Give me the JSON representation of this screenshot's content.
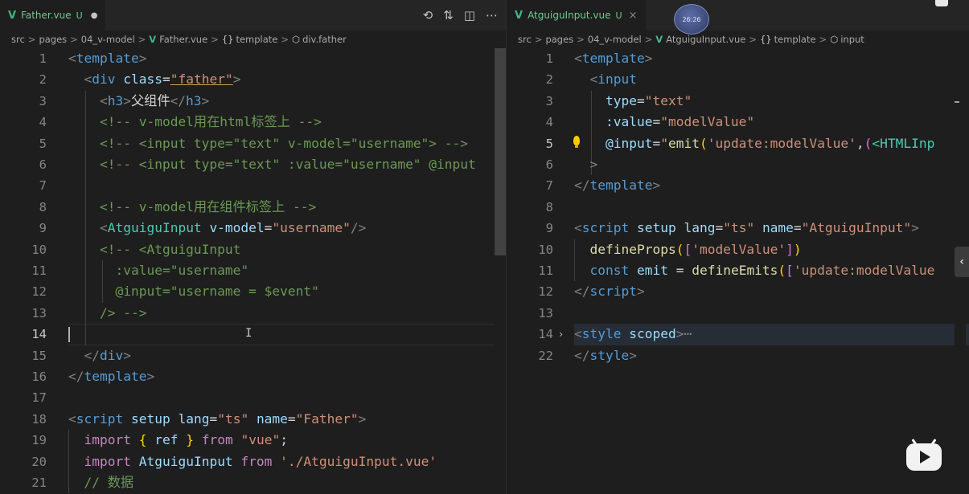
{
  "left": {
    "tab": {
      "vue_icon": "V",
      "name": "Father.vue",
      "status": "U",
      "dirty": "●"
    },
    "actions": {
      "history_icon": "⟲",
      "compare_icon": "⇅",
      "split_icon": "◫",
      "more_icon": "⋯"
    },
    "breadcrumb": [
      "src",
      "pages",
      "04_v-model",
      "Father.vue",
      "template",
      "div.father"
    ],
    "breadcrumb_symbols": {
      "template_sym": "{}",
      "div_sym": "⬡"
    },
    "line_numbers": [
      "1",
      "2",
      "3",
      "4",
      "5",
      "6",
      "7",
      "8",
      "9",
      "10",
      "11",
      "12",
      "13",
      "14",
      "15",
      "16",
      "17",
      "18",
      "19",
      "20",
      "21"
    ],
    "active_line": "14",
    "code": {
      "l1": [
        "<",
        "template",
        ">"
      ],
      "l2": [
        "<",
        "div",
        "class",
        "=",
        "\"father\"",
        ">"
      ],
      "l3": [
        "<",
        "h3",
        ">",
        "父组件",
        "</",
        "h3",
        ">"
      ],
      "l4": "<!-- v-model用在html标签上 -->",
      "l5": "<!-- <input type=\"text\" v-model=\"username\"> -->",
      "l6": "<!-- <input type=\"text\" :value=\"username\" @input",
      "l8": "<!-- v-model用在组件标签上 -->",
      "l9": [
        "<",
        "AtguiguInput",
        "v-model",
        "=",
        "\"username\"",
        "/>"
      ],
      "l10": "<!-- <AtguiguInput",
      "l11": ":value=\"username\"",
      "l12": "@input=\"username = $event\"",
      "l13": "/> -->",
      "l15": [
        "</",
        "div",
        ">"
      ],
      "l16": [
        "</",
        "template",
        ">"
      ],
      "l18": [
        "<",
        "script",
        "setup",
        "lang",
        "=",
        "\"ts\"",
        "name",
        "=",
        "\"Father\"",
        ">"
      ],
      "l19": [
        "import",
        "{",
        "ref",
        "}",
        "from",
        "\"vue\"",
        ";"
      ],
      "l20": [
        "import",
        "AtguiguInput",
        "from",
        "'./AtguiguInput.vue'"
      ],
      "l21": "// 数据"
    },
    "text_cursor_icon": "I"
  },
  "right": {
    "tab": {
      "vue_icon": "V",
      "name": "AtguiguInput.vue",
      "status": "U",
      "close": "×"
    },
    "breadcrumb": [
      "src",
      "pages",
      "04_v-model",
      "AtguiguInput.vue",
      "template",
      "input"
    ],
    "breadcrumb_symbols": {
      "template_sym": "{}",
      "input_sym": "⬡"
    },
    "line_numbers": [
      "1",
      "2",
      "3",
      "4",
      "5",
      "6",
      "7",
      "8",
      "9",
      "10",
      "11",
      "12",
      "13",
      "14",
      "22"
    ],
    "active_line": "5",
    "code": {
      "l1": [
        "<",
        "template",
        ">"
      ],
      "l2": [
        "<",
        "input"
      ],
      "l3": [
        "type",
        "=",
        "\"text\""
      ],
      "l4": [
        ":value",
        "=",
        "\"modelValue\""
      ],
      "l5": [
        "@input",
        "=",
        "\"",
        "emit",
        "(",
        "'update:modelValue'",
        ",",
        "(",
        "<HTMLInp"
      ],
      "l6": ">",
      "l7": [
        "</",
        "template",
        ">"
      ],
      "l9": [
        "<",
        "script",
        "setup",
        "lang",
        "=",
        "\"ts\"",
        "name",
        "=",
        "\"AtguiguInput\"",
        ">"
      ],
      "l10": [
        "defineProps",
        "(",
        "[",
        "'modelValue'",
        "]",
        ")"
      ],
      "l11": [
        "const",
        "emit",
        "=",
        "defineEmits",
        "(",
        "[",
        "'update:modelValue"
      ],
      "l12": [
        "</",
        "script",
        ">"
      ],
      "l14": [
        "<",
        "style",
        "scoped",
        ">",
        "⋯"
      ],
      "l22": [
        "</",
        "style",
        ">"
      ]
    },
    "fold_chevron": "›",
    "side_chevron": "‹"
  },
  "overlay": {
    "timer": "26:26"
  },
  "colors": {
    "background": "#1e1e1e",
    "tab_bar": "#252526",
    "vue_green": "#41b883",
    "untracked": "#73c991"
  }
}
